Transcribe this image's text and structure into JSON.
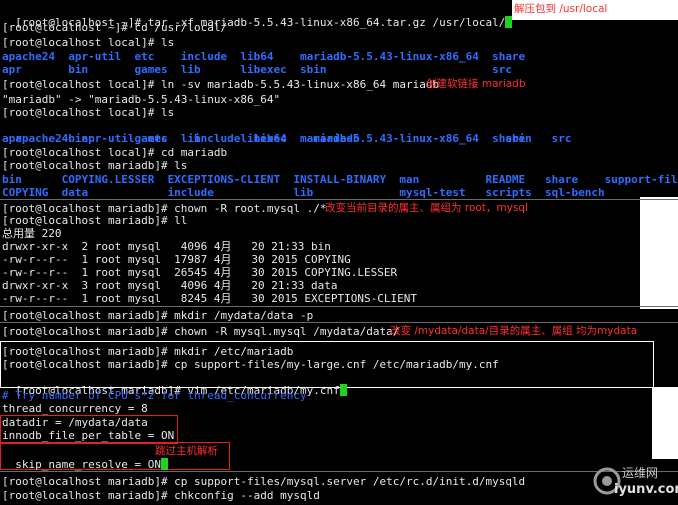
{
  "lines": [
    {
      "p": "[root@localhost ~]# tar -xf mariadb-5.5.43-linux-x86_64.tar.gz /usr/local/"
    },
    {
      "p": "[root@localhost ~]# cd /usr/local/"
    },
    {
      "p": "[root@localhost local]# ls"
    },
    {
      "p": "apache24  apr-util  etc    include  lib64    mariadb-5.5.43-linux-x86_64  share"
    },
    {
      "p": "apr       bin       games  lib      libexec  sbin                         src"
    },
    {
      "p": "[root@localhost local]# ln -sv mariadb-5.5.43-linux-x86_64 mariadb"
    },
    {
      "p": "\"mariadb\" -> \"mariadb-5.5.43-linux-x86_64\""
    },
    {
      "p": "[root@localhost local]# ls"
    },
    {
      "p": "apache24  apr-util  etc    include  lib64    mariadb                      sbin   src"
    },
    {
      "p": "apr       bin       games  lib      libexec  mariadb-5.5.43-linux-x86_64  share"
    },
    {
      "p": "[root@localhost local]# cd mariadb"
    },
    {
      "p": "[root@localhost mariadb]# ls"
    },
    {
      "p": "bin      COPYING.LESSER  EXCEPTIONS-CLIENT  INSTALL-BINARY  man          README   share    support-files"
    },
    {
      "p": "COPYING  data            include            lib             mysql-test   scripts  sql-bench"
    },
    {
      "p": "[root@localhost mariadb]# chown -R root.mysql ./*"
    },
    {
      "p": "[root@localhost mariadb]# ll"
    },
    {
      "p": "总用量 220"
    },
    {
      "p": "drwxr-xr-x  2 root mysql   4096 4月   20 21:33 bin"
    },
    {
      "p": "-rw-r--r--  1 root mysql  17987 4月   30 2015 COPYING"
    },
    {
      "p": "-rw-r--r--  1 root mysql  26545 4月   30 2015 COPYING.LESSER"
    },
    {
      "p": "drwxr-xr-x  3 root mysql   4096 4月   20 21:33 data"
    },
    {
      "p": "-rw-r--r--  1 root mysql   8245 4月   30 2015 EXCEPTIONS-CLIENT"
    },
    {
      "p": "[root@localhost mariadb]# mkdir /mydata/data -p"
    },
    {
      "p": "[root@localhost mariadb]# chown -R mysql.mysql /mydata/data/"
    },
    {
      "p": "[root@localhost mariadb]# mkdir /etc/mariadb"
    },
    {
      "p": "[root@localhost mariadb]# cp support-files/my-large.cnf /etc/mariadb/my.cnf"
    },
    {
      "p": "[root@localhost mariadb]# vim /etc/mariadb/my.cnf"
    },
    {
      "p": "# Try number of CPU's*2 for thread_concurrency"
    },
    {
      "p": "thread_concurrency = 8"
    },
    {
      "p": "datadir = /mydata/data"
    },
    {
      "p": "innodb_file_per_table = ON"
    },
    {
      "p": "skip_name_resolve = ON"
    },
    {
      "p": "[root@localhost mariadb]# cp support-files/mysql.server /etc/rc.d/init.d/mysqld"
    },
    {
      "p": "[root@localhost mariadb]# chkconfig --add mysqld"
    }
  ],
  "annotations": {
    "extract": "解压包到 /usr/local",
    "symlink": "创建软链接 mariadb",
    "chown_root": "改变当前目录的属主、属组为 root，mysql",
    "chown_mysql": "改变 /mydata/data/目录的属主、属组 均为mydata",
    "skip_resolve": "跳过主机解析"
  },
  "watermark": {
    "cn": "运维网",
    "url": "iyunv.com"
  },
  "colors": {
    "directory": "#2f6cff",
    "symlink": "#27c9d0",
    "annotation": "#ff3030",
    "cursor": "#21d321"
  }
}
